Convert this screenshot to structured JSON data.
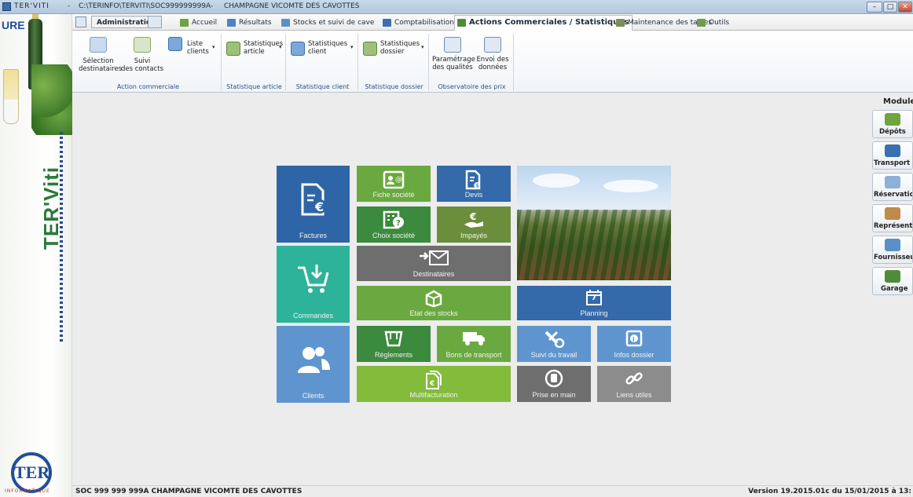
{
  "window": {
    "app_name": "TER'VITI",
    "separator": "-",
    "path": "C:\\TERINFO\\TERVITI\\SOC999999999A",
    "company": "CHAMPAGNE VICOMTE DES CAVOTTES",
    "minimize": "–",
    "maximize": "□",
    "close": "✕"
  },
  "branding": {
    "top_text": "URE",
    "vertical_text": "TER'Viti",
    "logo_text": "TER",
    "logo_caption": "INFORMATIQUE"
  },
  "tabs": {
    "administration": "Administration",
    "accueil": "Accueil",
    "resultats": "Résultats",
    "stocks": "Stocks et suivi de cave",
    "comptabilisation": "Comptabilisation",
    "actions": "Actions Commerciales / Statistiques",
    "maintenance": "Maintenance des tables",
    "outils": "Outils"
  },
  "ribbon": {
    "groups": {
      "action_commerciale": "Action commerciale",
      "statistique_article": "Statistique article",
      "statistique_client": "Statistique client",
      "statistique_dossier": "Statistique dossier",
      "observatoire": "Observatoire des prix"
    },
    "buttons": {
      "selection_l1": "Sélection",
      "selection_l2": "destinataires",
      "suivi_l1": "Suivi",
      "suivi_l2": "des contacts",
      "liste_l1": "Liste",
      "liste_l2": "clients",
      "stat_article_l1": "Statistiques",
      "stat_article_l2": "article",
      "stat_client_l1": "Statistiques",
      "stat_client_l2": "client",
      "stat_dossier_l1": "Statistiques",
      "stat_dossier_l2": "dossier",
      "param_l1": "Paramétrage",
      "param_l2": "des qualités",
      "envoi_l1": "Envoi des",
      "envoi_l2": "données"
    }
  },
  "tiles": {
    "factures": "Factures",
    "fiche_societe": "Fiche société",
    "devis": "Devis",
    "choix_societe": "Choix société",
    "impayes": "Impayés",
    "commandes": "Commandes",
    "destinataires": "Destinataires",
    "etat_stocks": "Etat des stocks",
    "planning": "Planning",
    "planning_day": "7",
    "clients": "Clients",
    "reglements": "Règlements",
    "bons_transport": "Bons de transport",
    "suivi_travail": "Suivi du travail",
    "infos_dossier": "Infos dossier",
    "multifacturation": "Multifacturation",
    "prise_en_main": "Prise en main",
    "liens_utiles": "Liens utiles"
  },
  "modules": {
    "title": "Modules",
    "items": [
      "Dépôts",
      "Transport",
      "Réservation",
      "Représent",
      "Fournisseu",
      "Garage"
    ]
  },
  "status": {
    "left": "SOC 999 999 999A  CHAMPAGNE VICOMTE DES CAVOTTES",
    "right": "Version 19.2015.01c du 15/01/2015 à 13:"
  },
  "colors": {
    "blue_dark": "#2e65a6",
    "blue_light": "#5f95cf",
    "green": "#6aa93f",
    "green_dark": "#3b8a3d",
    "green_lime": "#83bb3b",
    "teal": "#2cb39a",
    "grey": "#6e6e6e"
  }
}
